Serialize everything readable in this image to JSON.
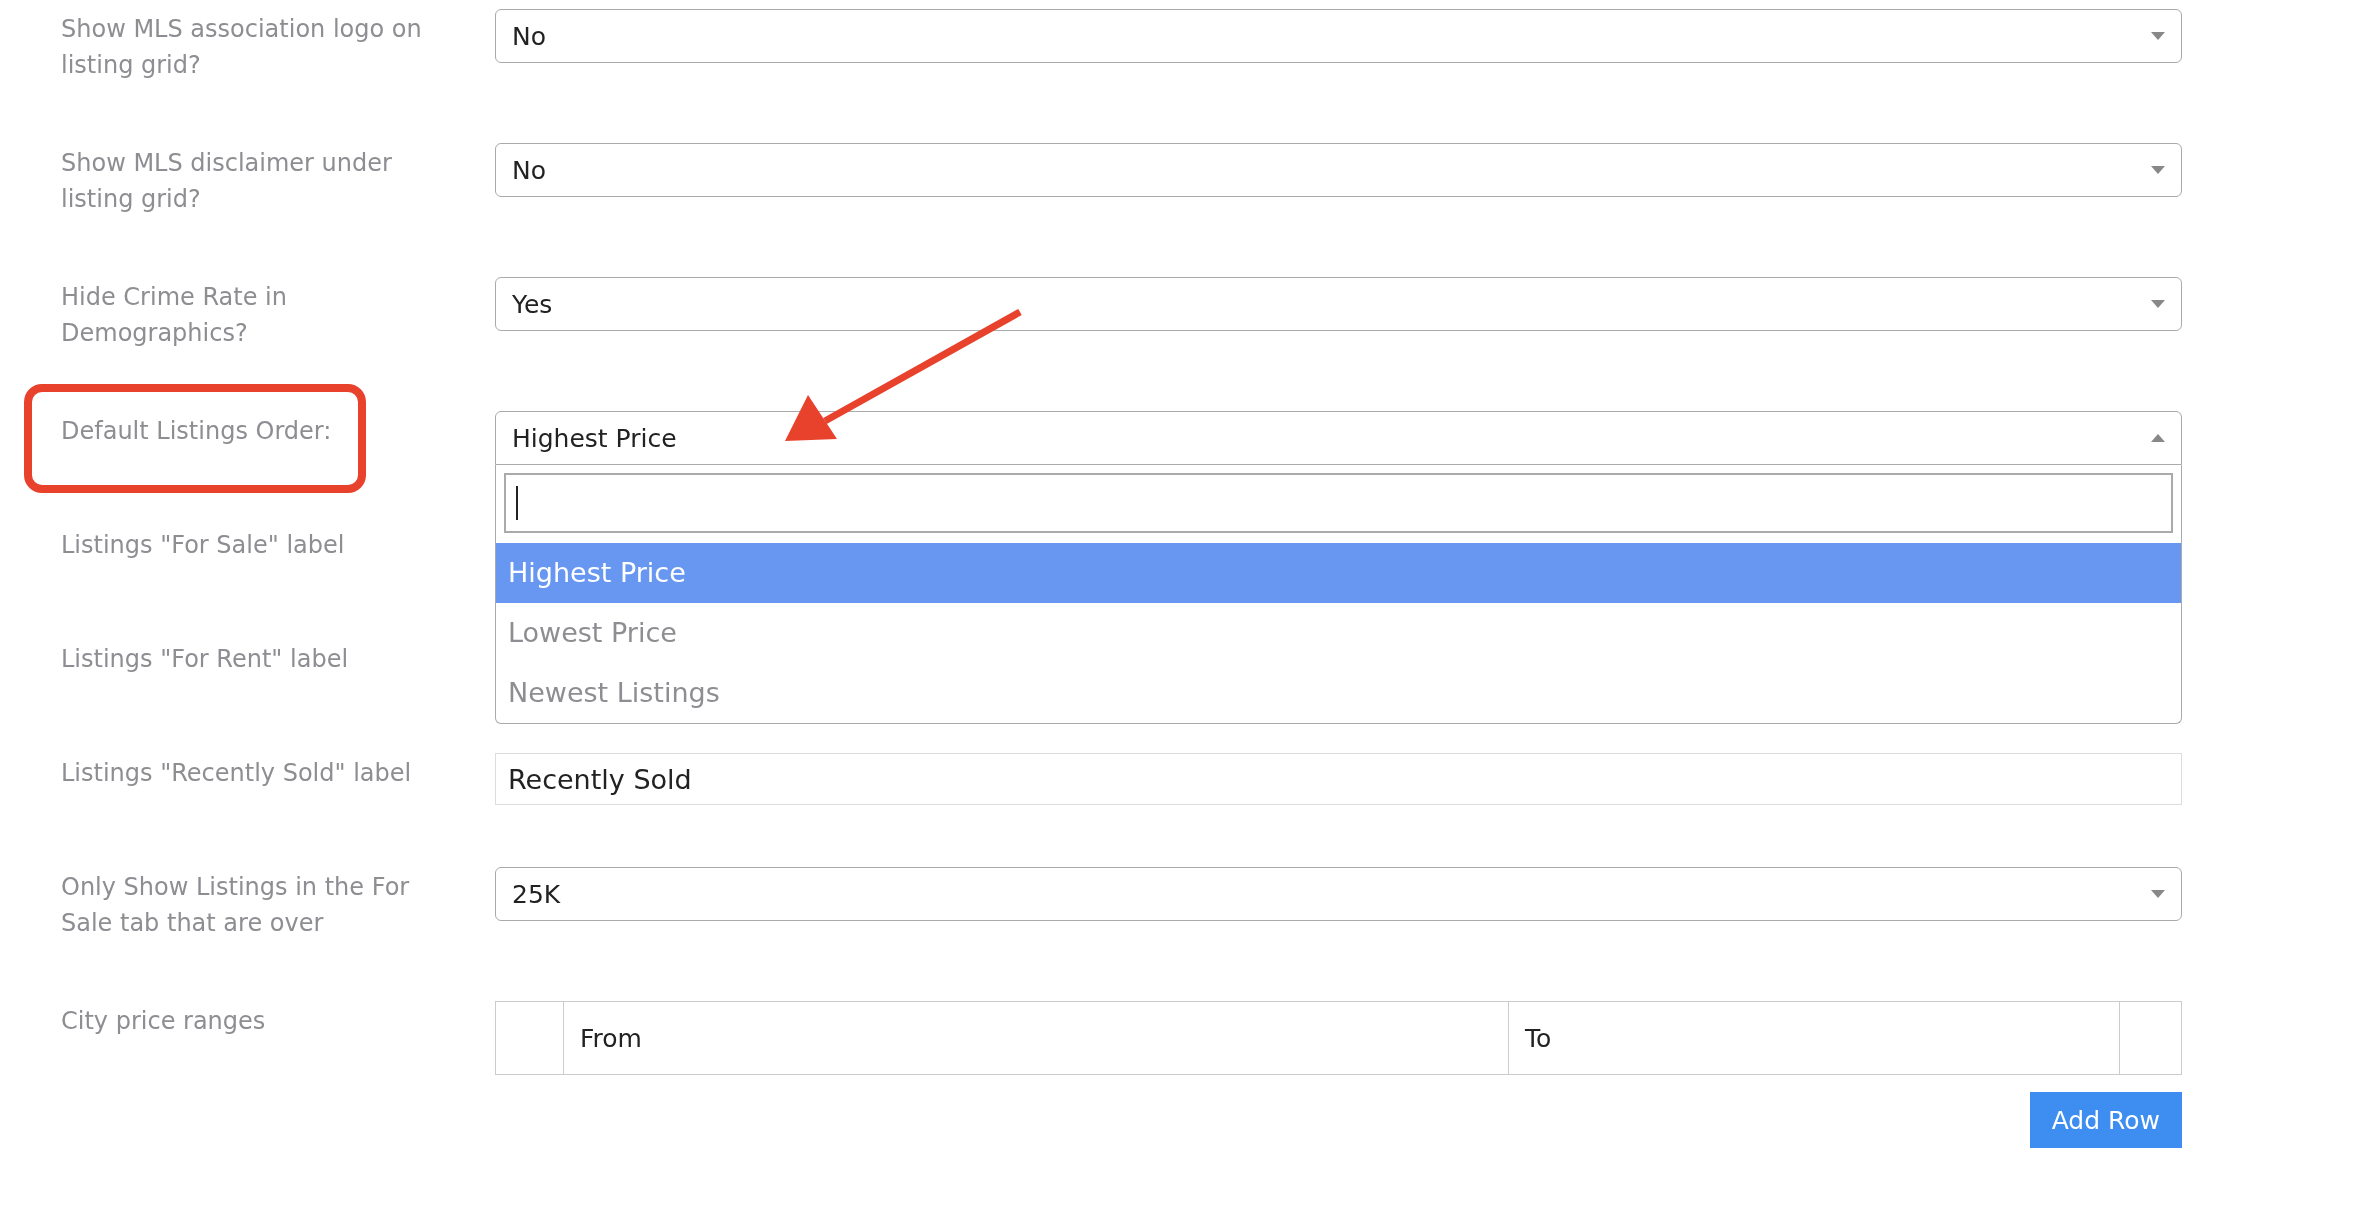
{
  "fields": [
    {
      "label": "Show MLS association logo on listing grid?",
      "kind": "select",
      "value": "No"
    },
    {
      "label": "Show MLS disclaimer under listing grid?",
      "kind": "select",
      "value": "No"
    },
    {
      "label": "Hide Crime Rate in Demographics?",
      "kind": "select",
      "value": "Yes"
    },
    {
      "label": "Default Listings Order:",
      "kind": "select",
      "value": "Highest Price",
      "highlighted": true,
      "expanded": true,
      "annotation_arrow": true,
      "options": [
        {
          "label": "Highest Price",
          "selected": true
        },
        {
          "label": "Lowest Price",
          "selected": false
        },
        {
          "label": "Newest Listings",
          "selected": false
        }
      ]
    },
    {
      "label": "Listings \"For Sale\" label",
      "kind": "covered"
    },
    {
      "label": "Listings \"For Rent\" label",
      "kind": "covered"
    },
    {
      "label": "Listings \"Recently Sold\" label",
      "kind": "text",
      "value": "Recently Sold"
    },
    {
      "label": "Only Show Listings in the For Sale tab that are over",
      "kind": "select",
      "value": "25K"
    },
    {
      "label": "City price ranges",
      "kind": "table",
      "columns": [
        "",
        "From",
        "To",
        ""
      ],
      "button": "Add Row"
    }
  ]
}
